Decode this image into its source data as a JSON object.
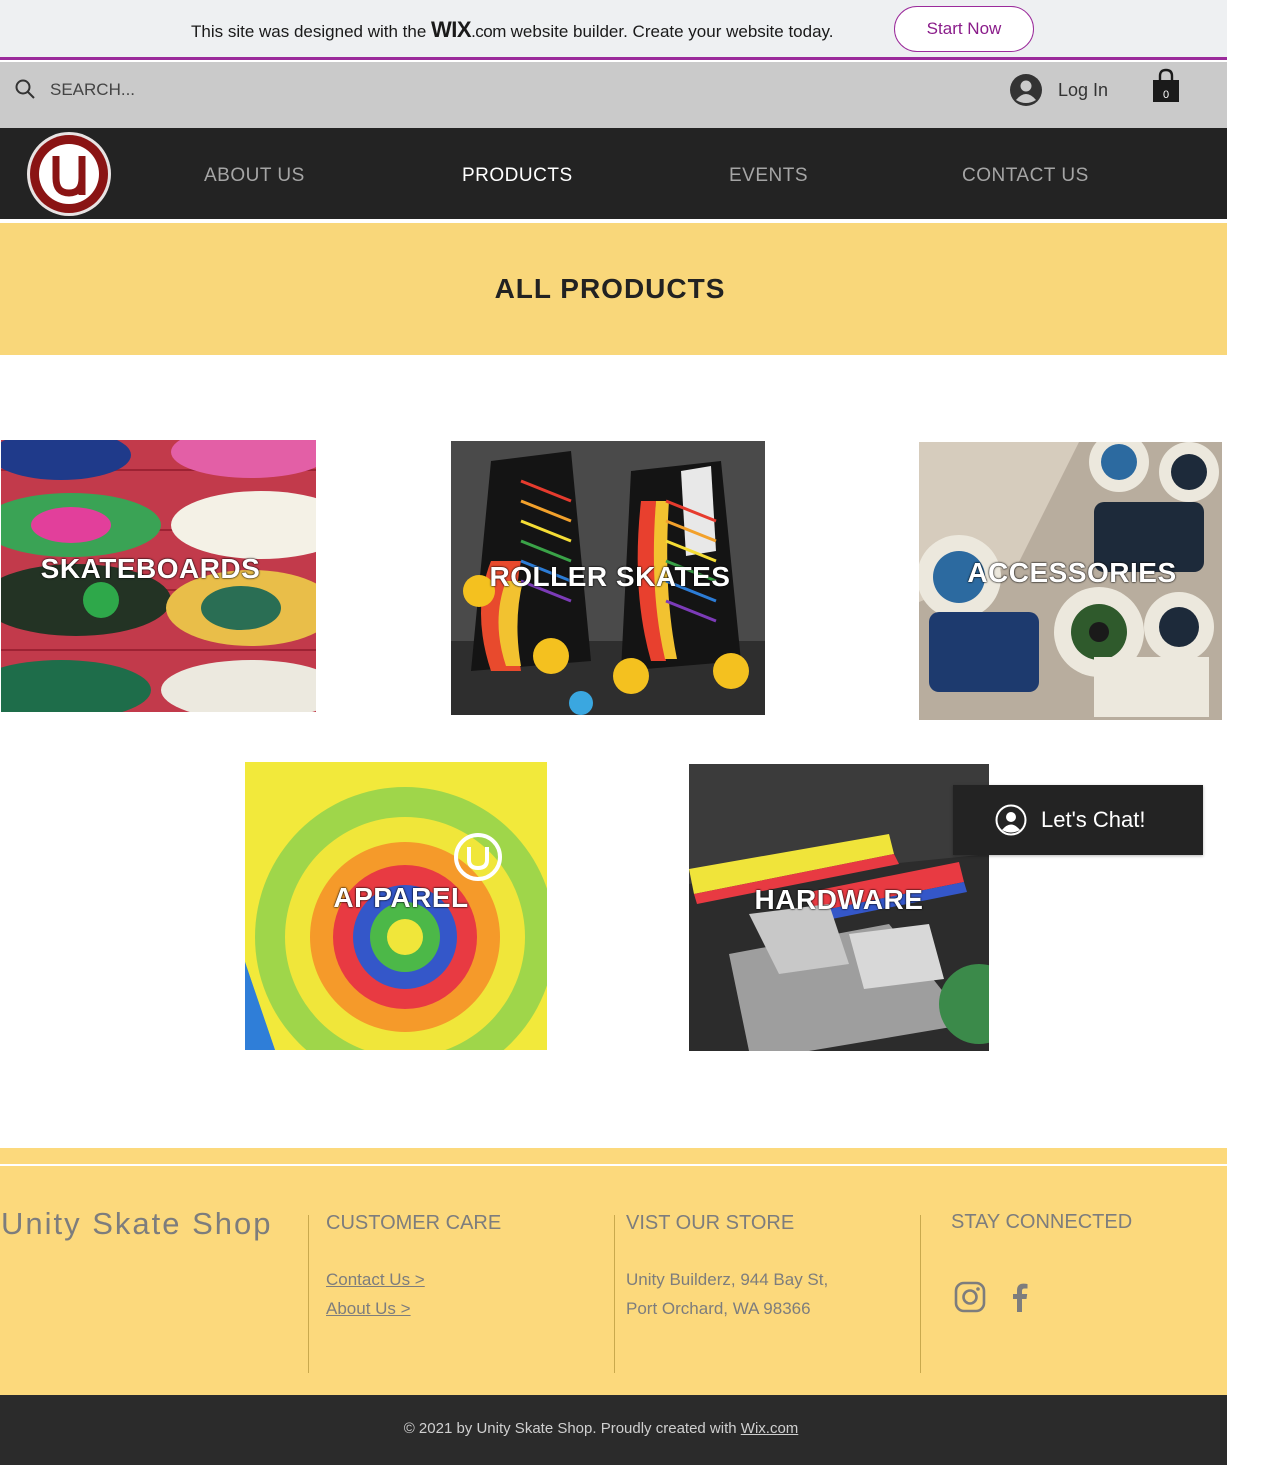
{
  "banner": {
    "text_before": "This site was designed with the ",
    "logo_main": "WIX",
    "logo_domain": ".com",
    "text_after": " website builder. Create your website today.",
    "cta": "Start Now",
    "accent": "#9b2b9b"
  },
  "topbar": {
    "search_placeholder": "SEARCH...",
    "search_icon": "search-icon",
    "login_label": "Log In",
    "login_icon": "user-avatar-icon",
    "cart_count": "0",
    "cart_icon": "shopping-bag-icon"
  },
  "nav": {
    "logo": "unity-u-logo",
    "items": [
      {
        "label": "ABOUT US",
        "active": false
      },
      {
        "label": "PRODUCTS",
        "active": true
      },
      {
        "label": "EVENTS",
        "active": false
      },
      {
        "label": "CONTACT US",
        "active": false
      }
    ]
  },
  "hero": {
    "title": "ALL PRODUCTS",
    "background": "#f9d77a"
  },
  "products": [
    {
      "label": "SKATEBOARDS"
    },
    {
      "label": "ROLLER SKATES"
    },
    {
      "label": "ACCESSORIES"
    },
    {
      "label": "APPAREL"
    },
    {
      "label": "HARDWARE"
    }
  ],
  "chat": {
    "label": "Let's Chat!",
    "icon": "user-avatar-icon"
  },
  "footer": {
    "brand": "Unity Skate Shop",
    "customer_care": {
      "heading": "CUSTOMER CARE",
      "links": [
        "Contact Us >",
        "About Us >"
      ]
    },
    "store": {
      "heading": "VIST OUR STORE",
      "address_line1": "Unity Builderz, 944 Bay St,",
      "address_line2": "Port Orchard, WA 98366"
    },
    "social": {
      "heading": "STAY CONNECTED",
      "icons": [
        "instagram-icon",
        "facebook-icon"
      ]
    },
    "background": "#fcd97c"
  },
  "bottom": {
    "copyright_prefix": "© 2021 by Unity Skate Shop. Proudly created with ",
    "copyright_link": "Wix.com"
  }
}
